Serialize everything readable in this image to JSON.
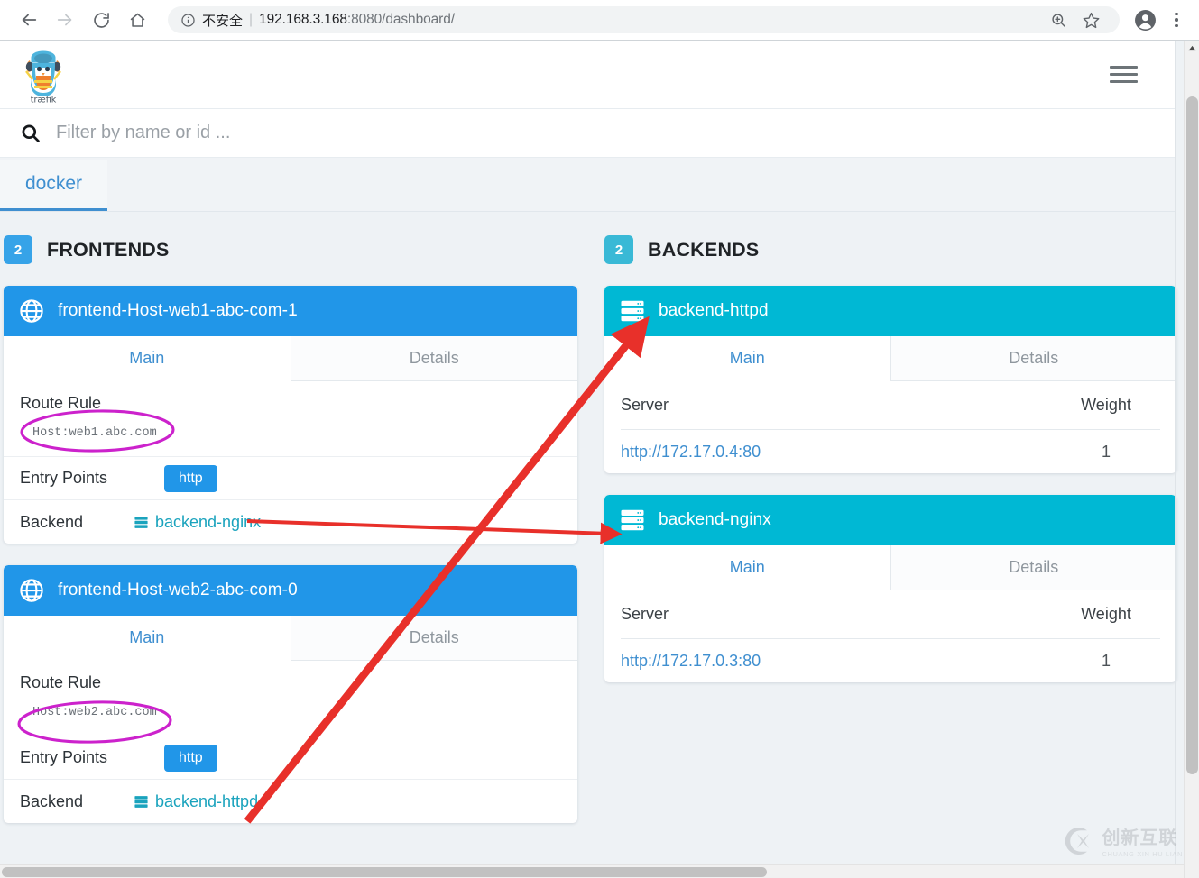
{
  "browser": {
    "back_icon": "back-arrow-icon",
    "forward_icon": "forward-arrow-icon",
    "reload_icon": "reload-icon",
    "home_icon": "home-icon",
    "security_label": "不安全",
    "url_host": "192.168.3.168",
    "url_port_path": ":8080/dashboard/",
    "zoom_icon": "zoom-in-icon",
    "bookmark_icon": "star-icon",
    "profile_icon": "profile-avatar-icon",
    "menu_icon": "three-dot-menu-icon"
  },
  "app": {
    "brand_name": "træfik",
    "menu_icon": "hamburger-menu-icon",
    "search": {
      "icon": "search-icon",
      "placeholder": "Filter by name or id ...",
      "value": ""
    },
    "provider_tabs": [
      {
        "label": "docker",
        "active": true
      }
    ]
  },
  "frontends": {
    "count": "2",
    "heading": "FRONTENDS",
    "items": [
      {
        "name": "frontend-Host-web1-abc-com-1",
        "icon": "globe-icon",
        "tabs": [
          {
            "label": "Main",
            "active": true
          },
          {
            "label": "Details",
            "active": false
          }
        ],
        "route_rule_label": "Route Rule",
        "route_rule_value": "Host:web1.abc.com",
        "entry_points_label": "Entry Points",
        "entry_points": [
          "http"
        ],
        "backend_label": "Backend",
        "backend_name": "backend-nginx",
        "backend_icon": "server-rack-icon"
      },
      {
        "name": "frontend-Host-web2-abc-com-0",
        "icon": "globe-icon",
        "tabs": [
          {
            "label": "Main",
            "active": true
          },
          {
            "label": "Details",
            "active": false
          }
        ],
        "route_rule_label": "Route Rule",
        "route_rule_value": "Host:web2.abc.com",
        "entry_points_label": "Entry Points",
        "entry_points": [
          "http"
        ],
        "backend_label": "Backend",
        "backend_name": "backend-httpd",
        "backend_icon": "server-rack-icon"
      }
    ]
  },
  "backends": {
    "count": "2",
    "heading": "BACKENDS",
    "items": [
      {
        "name": "backend-httpd",
        "icon": "server-rack-icon",
        "tabs": [
          {
            "label": "Main",
            "active": true
          },
          {
            "label": "Details",
            "active": false
          }
        ],
        "table": {
          "columns": [
            "Server",
            "Weight"
          ],
          "rows": [
            {
              "server": "http://172.17.0.4:80",
              "weight": "1"
            }
          ]
        }
      },
      {
        "name": "backend-nginx",
        "icon": "server-rack-icon",
        "tabs": [
          {
            "label": "Main",
            "active": true
          },
          {
            "label": "Details",
            "active": false
          }
        ],
        "table": {
          "columns": [
            "Server",
            "Weight"
          ],
          "rows": [
            {
              "server": "http://172.17.0.3:80",
              "weight": "1"
            }
          ]
        }
      }
    ]
  },
  "annotations": {
    "ellipse_color": "#cc22cc",
    "arrow_color": "#e8302a",
    "ellipses": [
      {
        "target": "Host:web1.abc.com"
      },
      {
        "target": "Host:web2.abc.com"
      }
    ],
    "arrows": [
      {
        "from": "frontend-web2 backend-httpd link",
        "to": "backend-httpd card",
        "style": "thick"
      },
      {
        "from": "frontend-web1 backend-nginx link",
        "to": "backend-nginx card",
        "style": "thin"
      }
    ]
  },
  "watermark": {
    "cn": "创新互联",
    "en": "CHUANG XIN HU LIAN",
    "logo_icon": "circle-x-logo-icon"
  },
  "colors": {
    "frontend_header": "#2196e8",
    "backend_header": "#00b8d4",
    "accent_link": "#3f8fd0",
    "backend_link": "#1aa3bd",
    "page_bg": "#eef2f5"
  }
}
